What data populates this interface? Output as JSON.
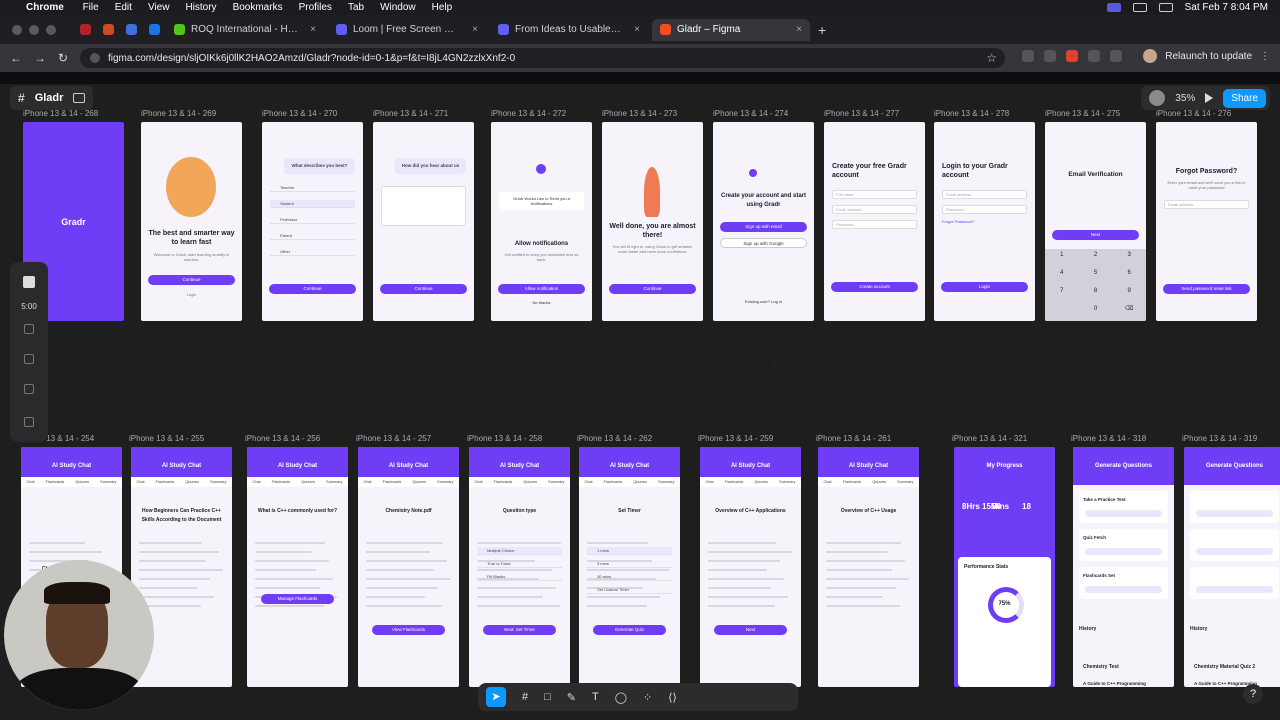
{
  "mac": {
    "app": "Chrome",
    "menus": [
      "File",
      "Edit",
      "View",
      "History",
      "Bookmarks",
      "Profiles",
      "Tab",
      "Window",
      "Help"
    ],
    "datetime": "Sat Feb 7  8:04 PM"
  },
  "tabs": [
    {
      "label": "ROQ International - Homepage",
      "color": "#52c41a"
    },
    {
      "label": "Loom | Free Screen & Video R",
      "color": "#625df5"
    },
    {
      "label": "From Ideas to Usable Solution",
      "color": "#625df5"
    },
    {
      "label": "Gladr – Figma",
      "color": "#f24e1e",
      "active": true
    }
  ],
  "browser": {
    "url": "figma.com/design/sljOIKk6j0llK2HAO2Amzd/Gladr?node-id=0-1&p=f&t=I8jL4GN2zzlxXnf2-0",
    "relaunch": "Relaunch to update"
  },
  "figma": {
    "file": "Gladr",
    "zoom": "35%",
    "share": "Share"
  },
  "rec": {
    "time": "5:00"
  },
  "frames_top": [
    {
      "label": "iPhone 13 & 14 - 268",
      "type": "splash",
      "brand": "Gradr"
    },
    {
      "label": "iPhone 13 & 14 - 269",
      "type": "welcome",
      "title": "The best and smarter way to learn fast",
      "sub": "Welcome to Gradr, start learning smartly in minutes.",
      "button": "Continue",
      "link": "Login"
    },
    {
      "label": "iPhone 13 & 14 - 270",
      "type": "question",
      "title": "What describes you best?",
      "options": [
        "Teacher",
        "Student",
        "Professor",
        "Parent",
        "Other"
      ],
      "button": "Continue"
    },
    {
      "label": "iPhone 13 & 14 - 271",
      "type": "question2",
      "title": "How did you hear about us",
      "button": "Continue"
    },
    {
      "label": "iPhone 13 & 14 - 272",
      "type": "notif",
      "title": "Allow notifications",
      "sub": "Get notified to keep you motivated and on track.",
      "dialog": "Gradr Would Like to Send you a Notifications",
      "button": "Allow notification",
      "link": "No thanks"
    },
    {
      "label": "iPhone 13 & 14 - 273",
      "type": "done",
      "title": "Well done, you are almost there!",
      "sub": "You will fit right in, using Gradr to get smarter, learn faster and have more confidence",
      "button": "Continue"
    },
    {
      "label": "iPhone 13 & 14 - 274",
      "type": "create",
      "title": "Create your account and start using Gradr",
      "button": "Sign up with email",
      "button2": "Sign up with Google",
      "link": "Existing user? Log in"
    },
    {
      "label": "iPhone 13 & 14 - 277",
      "type": "signup",
      "title": "Create your free Gradr account",
      "fields": [
        "Full name",
        "Email address",
        "Password"
      ],
      "button": "Create account"
    },
    {
      "label": "iPhone 13 & 14 - 278",
      "type": "login",
      "title": "Login to your Gradr account",
      "fields": [
        "Email address",
        "Password"
      ],
      "link": "Forgot Password?",
      "button": "Login"
    },
    {
      "label": "iPhone 13 & 14 - 275",
      "type": "verify",
      "title": "Email Verification",
      "button": "Next",
      "keys": [
        "1",
        "2",
        "3",
        "4",
        "5",
        "6",
        "7",
        "8",
        "9",
        "",
        "0",
        "⌫"
      ]
    },
    {
      "label": "iPhone 13 & 14 - 276",
      "type": "forgot",
      "title": "Forgot Password?",
      "sub": "Enter your email and we'll send you a link to reset your password",
      "field": "Email address",
      "button": "Send password reset link"
    }
  ],
  "frames_bottom": [
    {
      "label": "iPhone 13 & 14 - 254",
      "title": "AI Study Chat",
      "body": "Chat with Gradr AI Study"
    },
    {
      "label": "iPhone 13 & 14 - 255",
      "title": "AI Study Chat",
      "body": "How Beginners Can Practice C++ Skills According to the Document"
    },
    {
      "label": "iPhone 13 & 14 - 256",
      "title": "AI Study Chat",
      "body": "What is C++ commonly used for?",
      "button": "Manage Flashcards"
    },
    {
      "label": "iPhone 13 & 14 - 257",
      "title": "AI Study Chat",
      "body": "Chemistry Note.pdf",
      "button": "View Flashcards"
    },
    {
      "label": "iPhone 13 & 14 - 258",
      "title": "AI Study Chat",
      "body": "Question type",
      "options": [
        "Multiple Choice",
        "True or False",
        "Fill Blanks"
      ],
      "button": "Next: Set Timer"
    },
    {
      "label": "iPhone 13 & 14 - 262",
      "title": "AI Study Chat",
      "body": "Set Timer",
      "options": [
        "1 mins",
        "5 mins",
        "30 mins",
        "Set Custom Timer"
      ],
      "button": "Generate Quiz"
    },
    {
      "label": "iPhone 13 & 14 - 259",
      "title": "AI Study Chat",
      "body": "Overview of C++ Applications",
      "button": "Next"
    },
    {
      "label": "iPhone 13 & 14 - 261",
      "title": "AI Study Chat",
      "body": "Overview of C++ Usage"
    },
    {
      "label": "iPhone 13 & 14 - 321",
      "title": "My Progress",
      "stats": [
        "8Hrs 15Mins",
        "50",
        "18"
      ],
      "pct": "75%",
      "section": "Performance Stats"
    },
    {
      "label": "iPhone 13 & 14 - 318",
      "title": "Generate Questions",
      "items": [
        "Take a Practice Test",
        "Quiz Fetch",
        "Flashcards Set"
      ],
      "history": "History",
      "entry": "Chemistry Test",
      "footer": "A Guide to C++ Programming"
    },
    {
      "label": "iPhone 13 & 14 - 319",
      "title": "Generate Questions",
      "history": "History",
      "entry": "Chemistry Material Quiz 2",
      "footer": "A Guide to C++ Programming"
    }
  ]
}
